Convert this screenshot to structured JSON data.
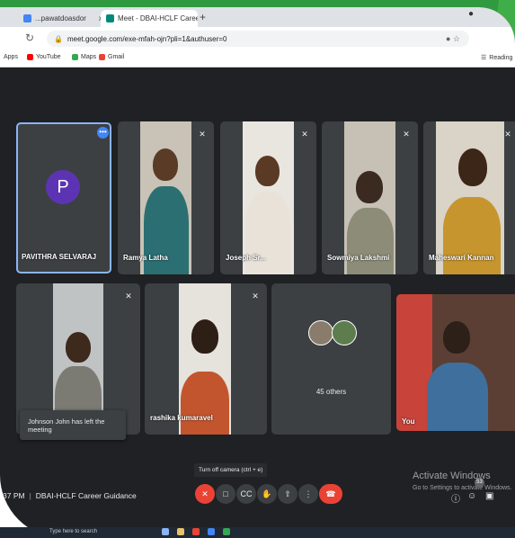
{
  "browser": {
    "tabs": [
      {
        "label": "...pawatdoasdor",
        "close": "x"
      },
      {
        "label": "Meet - DBAI-HCLF Career G...",
        "close": "x"
      }
    ],
    "new_tab": "+",
    "url": "meet.google.com/exe-mfah-ojn?pli=1&authuser=0",
    "reading_list": "Reading"
  },
  "bookmarks": [
    {
      "label": "Apps",
      "color": "#5f6368"
    },
    {
      "label": "YouTube",
      "color": "#ff0000"
    },
    {
      "label": "Maps",
      "color": "#34a853"
    },
    {
      "label": "Gmail",
      "color": "#ea4335"
    }
  ],
  "participants": [
    {
      "name": "PAVITHRA SELVARAJ",
      "initial": "P",
      "active": true
    },
    {
      "name": "Ramya Latha"
    },
    {
      "name": "Joseph Sr..."
    },
    {
      "name": "Sowmiya Lakshmi"
    },
    {
      "name": "Maheswari Kannan"
    },
    {
      "name": ""
    },
    {
      "name": "rashika kumaravel"
    },
    {
      "name": "You"
    }
  ],
  "others": {
    "label": "45 others"
  },
  "toast": "Johnson John has left the meeting",
  "tooltip": "Turn off camera (ctrl + e)",
  "meeting": {
    "time": "37 PM",
    "title": "DBAI-HCLF Career Guidance"
  },
  "activate": {
    "title": "Activate Windows",
    "sub": "Go to Settings to activate Windows."
  },
  "participant_count": "53",
  "taskbar": {
    "search": "Type here to search"
  },
  "colors": {
    "meet_bg": "#202124",
    "tile_bg": "#3c4043",
    "mute_red": "#ea4335",
    "avatar": "#5c34b3",
    "active_border": "#8ab4f8"
  }
}
